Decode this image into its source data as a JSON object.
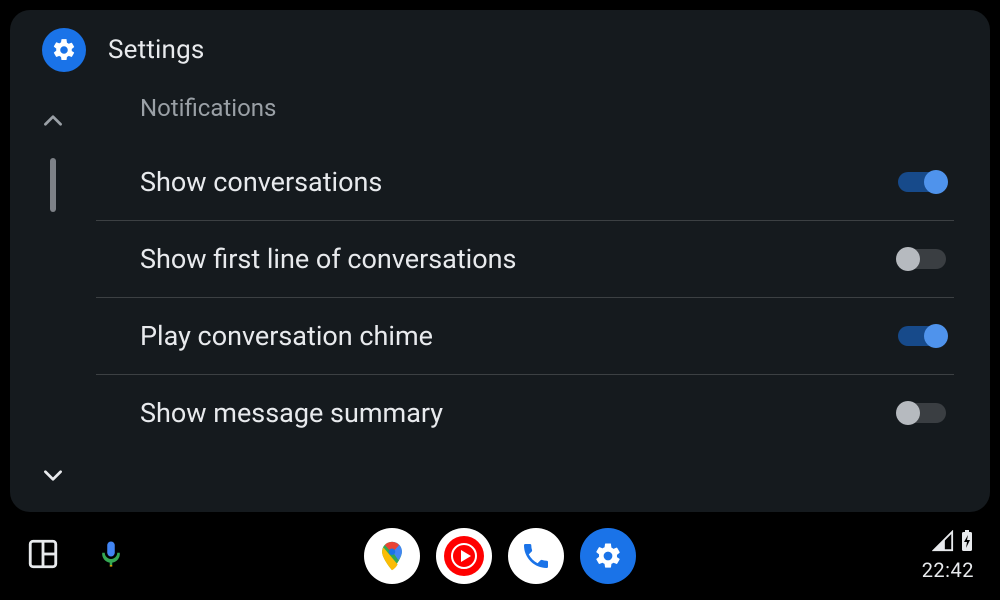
{
  "header": {
    "title": "Settings",
    "icon": "gear-icon"
  },
  "section": {
    "title": "Notifications"
  },
  "items": [
    {
      "label": "Show conversations",
      "on": true
    },
    {
      "label": "Show first line of conversations",
      "on": false
    },
    {
      "label": "Play conversation chime",
      "on": true
    },
    {
      "label": "Show message summary",
      "on": false
    }
  ],
  "navbar": {
    "apps": [
      {
        "name": "maps-app-icon"
      },
      {
        "name": "youtube-music-app-icon"
      },
      {
        "name": "phone-app-icon"
      },
      {
        "name": "settings-app-icon"
      }
    ],
    "clock": "22:42"
  },
  "colors": {
    "accent": "#1a73e8",
    "panel": "#151a1e",
    "text": "#e8eaed",
    "muted": "#9aa0a6"
  }
}
